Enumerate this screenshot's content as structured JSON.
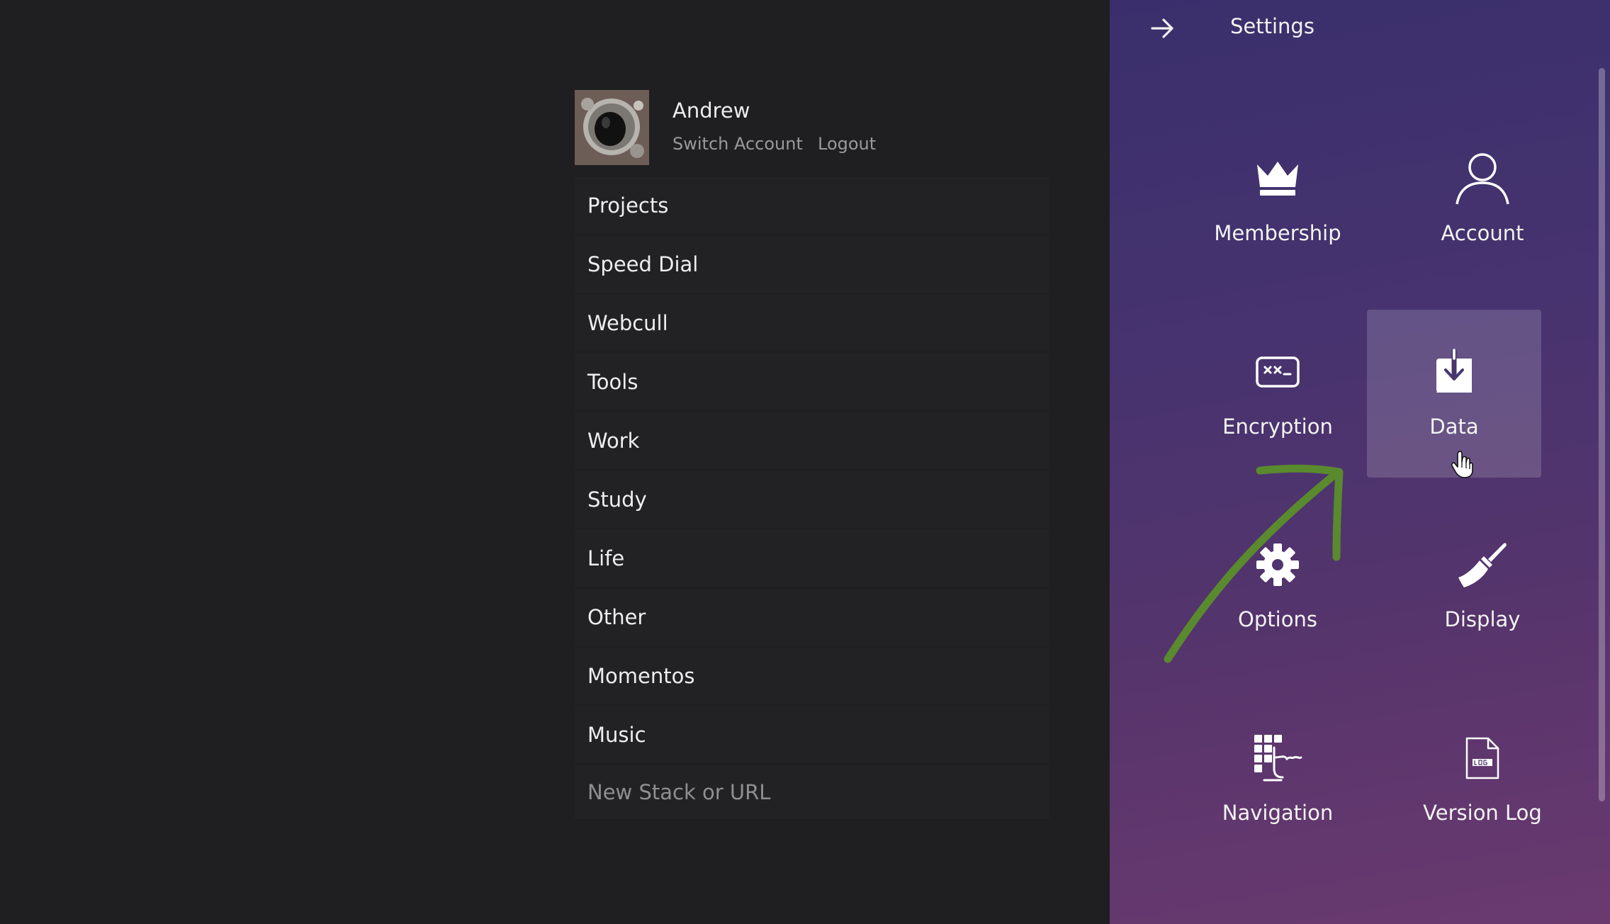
{
  "profile": {
    "name": "Andrew",
    "switch_account": "Switch Account",
    "logout": "Logout"
  },
  "stacks": {
    "items": [
      "Projects",
      "Speed Dial",
      "Webcull",
      "Tools",
      "Work",
      "Study",
      "Life",
      "Other",
      "Momentos",
      "Music"
    ],
    "new_placeholder": "New Stack or URL"
  },
  "settings": {
    "title": "Settings",
    "back_icon": "arrow-right-icon",
    "tiles": [
      {
        "label": "Membership",
        "icon": "crown-icon"
      },
      {
        "label": "Account",
        "icon": "user-icon"
      },
      {
        "label": "Encryption",
        "icon": "encryption-icon"
      },
      {
        "label": "Data",
        "icon": "download-icon",
        "active": true
      },
      {
        "label": "Options",
        "icon": "gear-icon"
      },
      {
        "label": "Display",
        "icon": "paintbrush-icon"
      },
      {
        "label": "Navigation",
        "icon": "keyboard-navigation-icon"
      },
      {
        "label": "Version Log",
        "icon": "log-file-icon"
      }
    ]
  },
  "colors": {
    "background": "#1f1f21",
    "list_item": "#222224",
    "panel_top": "#3a2f6c",
    "panel_bottom": "#6a3a6f",
    "annotation_arrow": "#5a8a2e"
  }
}
